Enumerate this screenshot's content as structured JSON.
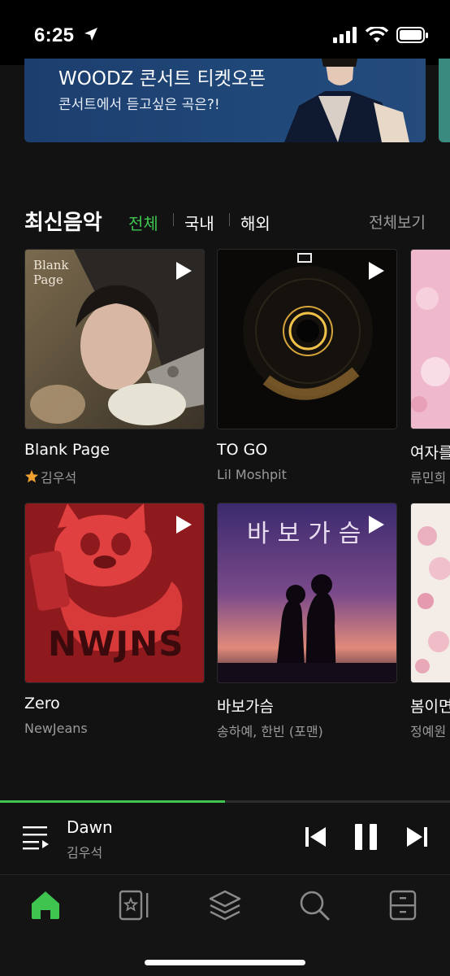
{
  "status_bar": {
    "time": "6:25"
  },
  "banner": {
    "title": "WOODZ 콘서트 티켓오픈",
    "subtitle": "콘서트에서 듣고싶은 곡은?!"
  },
  "section": {
    "title": "최신음악",
    "filters": [
      "전체",
      "국내",
      "해외"
    ],
    "active_filter": "전체",
    "view_all": "전체보기"
  },
  "albums": [
    {
      "title": "Blank Page",
      "artist": "김우석",
      "starred": true
    },
    {
      "title": "TO GO",
      "artist": "Lil Moshpit"
    },
    {
      "title": "여자를",
      "artist": "류민희"
    },
    {
      "title": "Zero",
      "artist": "NewJeans"
    },
    {
      "title": "바보가슴",
      "artist": "송하예, 한빈 (포맨)"
    },
    {
      "title": "봄이면",
      "artist": "정예원"
    }
  ],
  "cover_text": {
    "blank_page": "Blank Page",
    "newjeans": "NWJNS",
    "bapo": "바보가슴"
  },
  "now_playing": {
    "title": "Dawn",
    "artist": "김우석",
    "progress": 0.5
  },
  "colors": {
    "accent": "#3ec44f",
    "background": "#121212",
    "secondary_text": "#9a9a9a"
  },
  "tabs": [
    "home-icon",
    "favorites-icon",
    "library-icon",
    "search-icon",
    "storage-icon"
  ]
}
